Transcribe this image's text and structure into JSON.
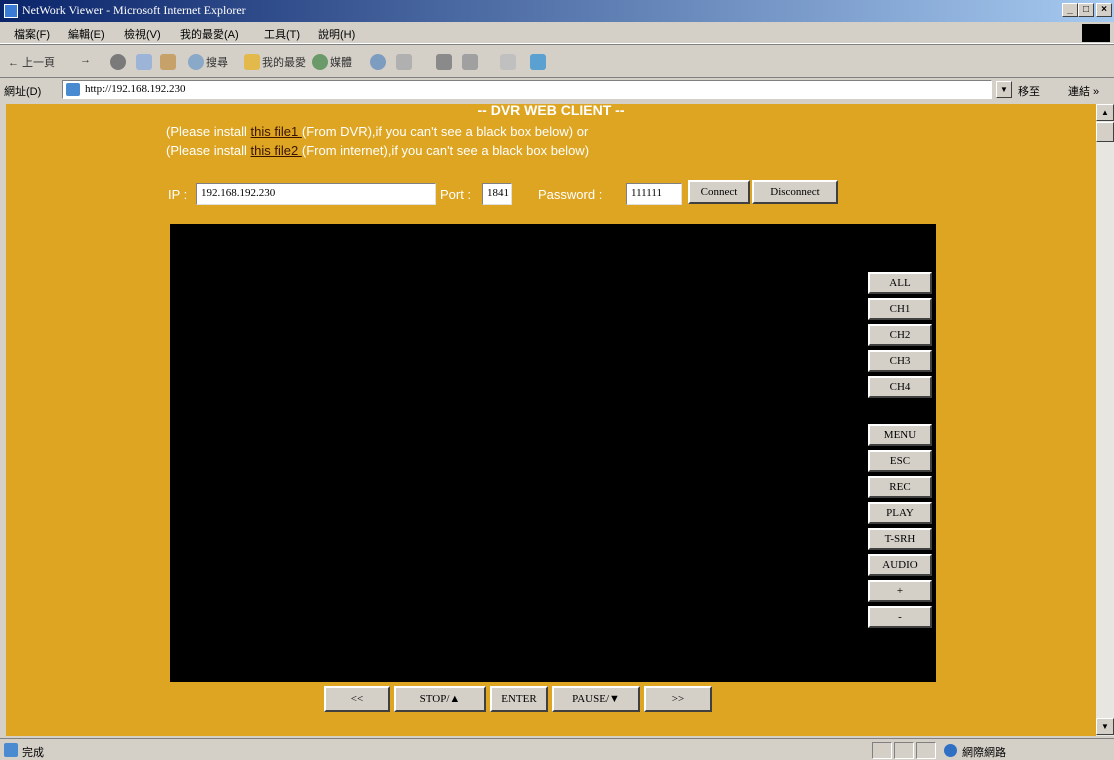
{
  "window": {
    "title": "NetWork Viewer - Microsoft Internet Explorer",
    "minimize": "_",
    "maximize": "□",
    "close": "×"
  },
  "menu": {
    "items": [
      "檔案(F)",
      "編輯(E)",
      "檢視(V)",
      "我的最愛(A)",
      "工具(T)",
      "說明(H)"
    ]
  },
  "toolbar": {
    "back_label": "← 上一頁",
    "forward_label": "→",
    "search_label": "搜尋",
    "favorites_label": "我的最愛",
    "media_label": "媒體"
  },
  "address": {
    "label": "網址(D)",
    "url": "http://192.168.192.230",
    "go_label": "移至",
    "links_label": "連結 »"
  },
  "page": {
    "heading": "-- DVR WEB CLIENT --",
    "note1_pre": "(Please install ",
    "note1_link": "this file1 ",
    "note1_post": "(From DVR),if you can't see a black box below) or",
    "note2_pre": "(Please install ",
    "note2_link": "this file2 ",
    "note2_post": "(From internet),if you can't see a black box below)",
    "ip_label": "IP :",
    "ip_value": "192.168.192.230",
    "port_label": "Port :",
    "port_value": "1841",
    "password_label": "Password :",
    "password_value": "111111",
    "connect_label": "Connect",
    "disconnect_label": "Disconnect"
  },
  "channels": [
    "ALL",
    "CH1",
    "CH2",
    "CH3",
    "CH4"
  ],
  "functions": [
    "MENU",
    "ESC",
    "REC",
    "PLAY",
    "T-SRH",
    "AUDIO",
    "+",
    "-"
  ],
  "controls": {
    "rewind": "<<",
    "stop": "STOP/▲",
    "enter": "ENTER",
    "pause": "PAUSE/▼",
    "forward": ">>"
  },
  "status": {
    "text": "完成",
    "zone": "網際網路"
  }
}
